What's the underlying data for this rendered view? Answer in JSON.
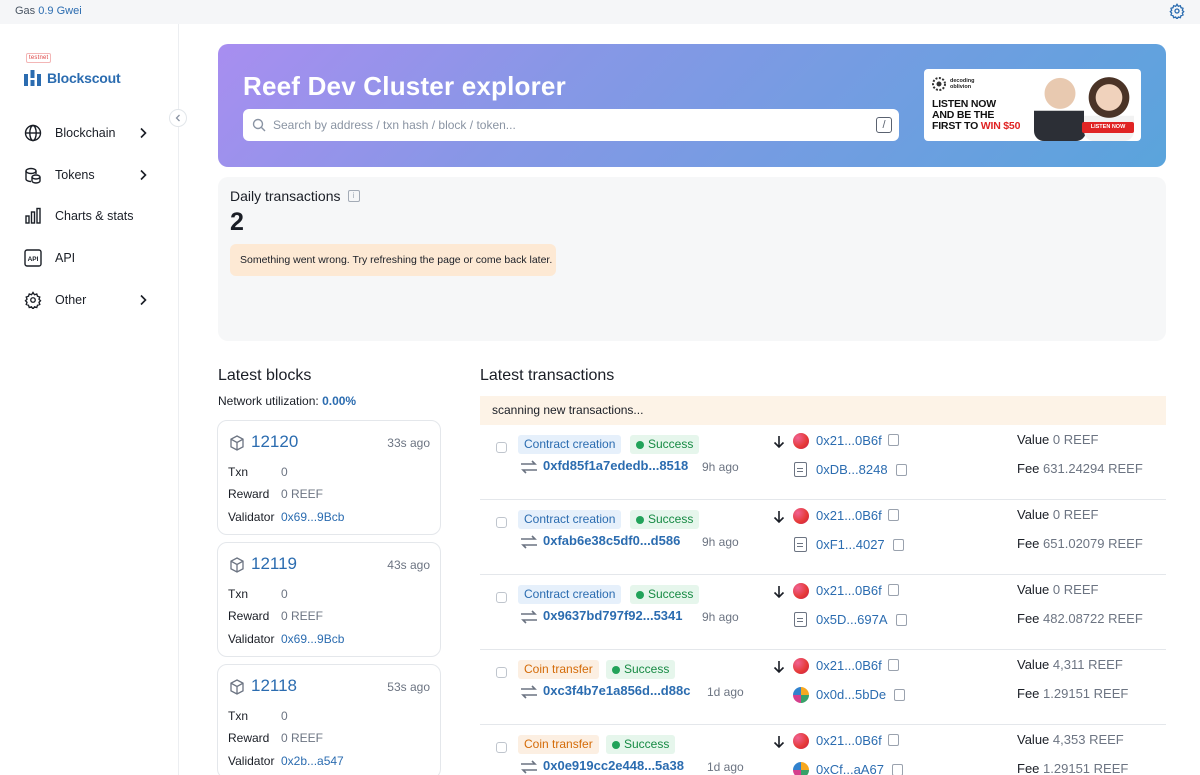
{
  "topbar": {
    "gas_label": "Gas",
    "gas_value": "0.9 Gwei"
  },
  "sidebar": {
    "network_badge": "testnet",
    "logo_text": "Blockscout",
    "items": [
      {
        "label": "Blockchain",
        "icon": "globe-icon",
        "has_submenu": true
      },
      {
        "label": "Tokens",
        "icon": "coins-icon",
        "has_submenu": true
      },
      {
        "label": "Charts & stats",
        "icon": "bar-chart-icon",
        "has_submenu": false
      },
      {
        "label": "API",
        "icon": "api-icon",
        "has_submenu": false
      },
      {
        "label": "Other",
        "icon": "gear-icon",
        "has_submenu": true
      }
    ]
  },
  "hero": {
    "title": "Reef Dev Cluster explorer",
    "search_placeholder": "Search by address / txn hash / block / token...",
    "search_shortcut": "/"
  },
  "ad": {
    "brand_line1": "decoding",
    "brand_line2": "oblivion",
    "headline_1": "LISTEN NOW",
    "headline_2": "AND BE THE",
    "headline_3": "FIRST TO",
    "headline_win": "WIN $50",
    "button": "LISTEN NOW"
  },
  "stats": {
    "daily_label": "Daily transactions",
    "daily_value": "2",
    "error": "Something went wrong. Try refreshing the page or come back later."
  },
  "latest_blocks": {
    "title": "Latest blocks",
    "utilization_label": "Network utilization:",
    "utilization_value": "0.00%",
    "labels": {
      "txn": "Txn",
      "reward": "Reward",
      "validator": "Validator"
    },
    "blocks": [
      {
        "number": "12120",
        "age": "33s ago",
        "txn": "0",
        "reward": "0 REEF",
        "validator": "0x69...9Bcb"
      },
      {
        "number": "12119",
        "age": "43s ago",
        "txn": "0",
        "reward": "0 REEF",
        "validator": "0x69...9Bcb"
      },
      {
        "number": "12118",
        "age": "53s ago",
        "txn": "0",
        "reward": "0 REEF",
        "validator": "0x2b...a547"
      }
    ]
  },
  "latest_transactions": {
    "title": "Latest transactions",
    "scanning": "scanning new transactions...",
    "value_label": "Value",
    "fee_label": "Fee",
    "txs": [
      {
        "type": "Contract creation",
        "kind": "contract",
        "status": "Success",
        "hash": "0xfd85f1a7ededb...8518",
        "age": "9h ago",
        "from": "0x21...0B6f",
        "to": "0xDB...8248",
        "to_kind": "contract",
        "value_num": "0",
        "value_unit": "REEF",
        "fee_num": "631.24294",
        "fee_unit": "REEF"
      },
      {
        "type": "Contract creation",
        "kind": "contract",
        "status": "Success",
        "hash": "0xfab6e38c5df0...d586",
        "age": "9h ago",
        "from": "0x21...0B6f",
        "to": "0xF1...4027",
        "to_kind": "contract",
        "value_num": "0",
        "value_unit": "REEF",
        "fee_num": "651.02079",
        "fee_unit": "REEF"
      },
      {
        "type": "Contract creation",
        "kind": "contract",
        "status": "Success",
        "hash": "0x9637bd797f92...5341",
        "age": "9h ago",
        "from": "0x21...0B6f",
        "to": "0x5D...697A",
        "to_kind": "contract",
        "value_num": "0",
        "value_unit": "REEF",
        "fee_num": "482.08722",
        "fee_unit": "REEF"
      },
      {
        "type": "Coin transfer",
        "kind": "coin",
        "status": "Success",
        "hash": "0xc3f4b7e1a856d...d88c",
        "age": "1d ago",
        "from": "0x21...0B6f",
        "to": "0x0d...5bDe",
        "to_kind": "address",
        "value_num": "4,311",
        "value_unit": "REEF",
        "fee_num": "1.29151",
        "fee_unit": "REEF"
      },
      {
        "type": "Coin transfer",
        "kind": "coin",
        "status": "Success",
        "hash": "0x0e919cc2e448...5a38",
        "age": "1d ago",
        "from": "0x21...0B6f",
        "to": "0xCf...aA67",
        "to_kind": "address",
        "value_num": "4,353",
        "value_unit": "REEF",
        "fee_num": "1.29151",
        "fee_unit": "REEF"
      }
    ]
  },
  "colors": {
    "accent": "#2b6cb0",
    "success": "#22a35a",
    "coin_transfer": "#d46b08",
    "hero_start": "#a88ef0",
    "hero_end": "#5aa4dc"
  }
}
